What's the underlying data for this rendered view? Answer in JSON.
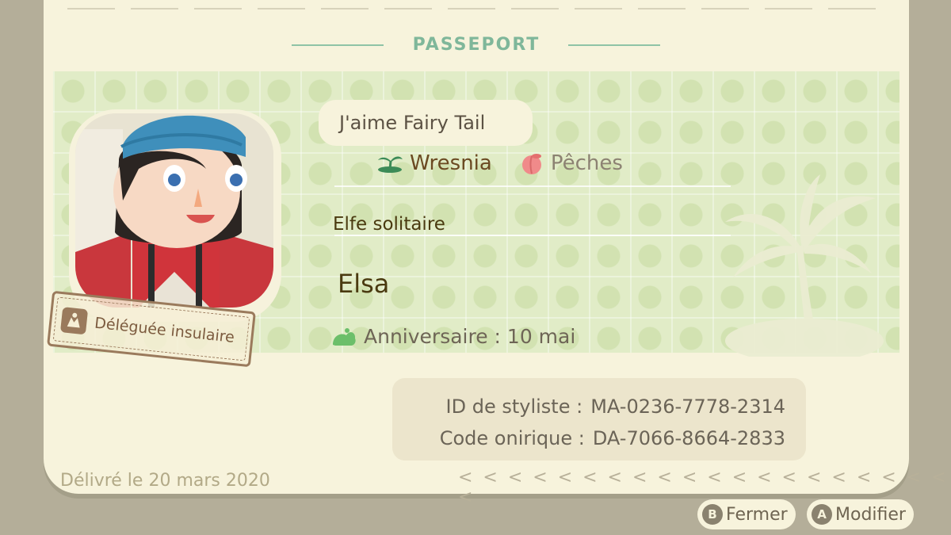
{
  "passport": {
    "title": "PASSEPORT",
    "comment": "J'aime Fairy Tail",
    "island": {
      "name": "Wresnia",
      "icon": "palm-island-icon"
    },
    "fruit": {
      "name": "Pêches",
      "icon": "peach-icon"
    },
    "user_title": "Elfe solitaire",
    "user_name": "Elsa",
    "birthday": "Anniversaire : 10 mai",
    "role_badge": "Déléguée insulaire",
    "designer_id_label": "ID de styliste :",
    "designer_id_value": "MA-0236-7778-2314",
    "dream_code_label": "Code onirique :",
    "dream_code_value": "DA-7066-8664-2833",
    "issued": "Délivré le 20 mars 2020",
    "chevrons": "< < < < < < < < < < < < < < < < < < < < <"
  },
  "controls": {
    "close": {
      "key": "B",
      "label": "Fermer"
    },
    "edit": {
      "key": "A",
      "label": "Modifier"
    }
  },
  "colors": {
    "background": "#b4ae99",
    "card": "#f7f3dc",
    "band": "#e1ecc7",
    "title_green": "#7fb79a",
    "stamp_brown": "#9a7a5c"
  }
}
